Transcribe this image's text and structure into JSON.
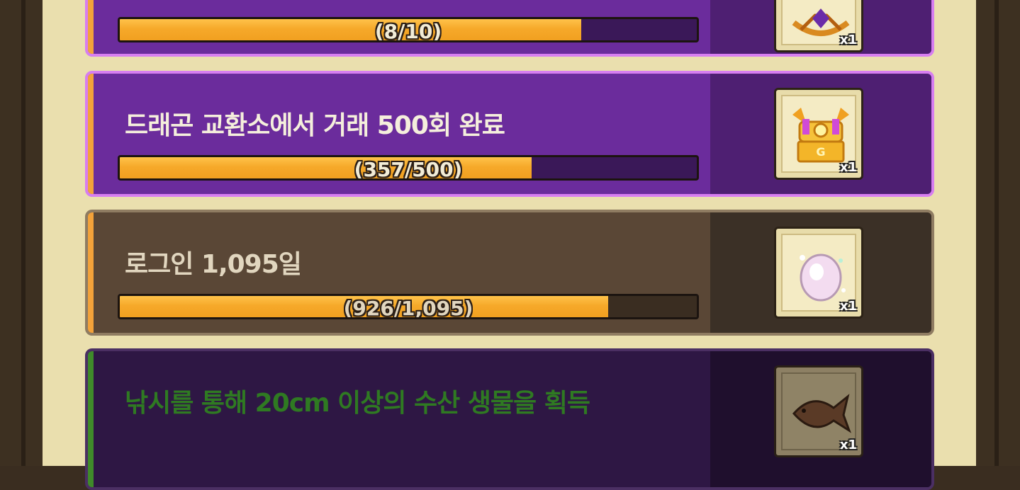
{
  "missions": [
    {
      "title": "",
      "progress_text": "(8/10)",
      "current": 8,
      "target": 10,
      "state": "active",
      "reward": {
        "icon": "gem-bow-icon",
        "qty": "x1"
      }
    },
    {
      "title": "드래곤 교환소에서 거래 500회 완료",
      "progress_text": "(357/500)",
      "current": 357,
      "target": 500,
      "state": "active",
      "reward": {
        "icon": "golden-treasure-chest-icon",
        "qty": "x1"
      }
    },
    {
      "title": "로그인 1,095일",
      "progress_text": "(926/1,095)",
      "current": 926,
      "target": 1095,
      "state": "inactive",
      "reward": {
        "icon": "pink-egg-icon",
        "qty": "x1"
      }
    },
    {
      "title": "낚시를 통해 20cm 이상의 수산 생물을 획득",
      "state": "locked",
      "reward": {
        "icon": "fish-icon",
        "qty": "x1"
      }
    }
  ],
  "colors": {
    "active_bg": "#6a2a9a",
    "inactive_bg": "#5a4736",
    "locked_bg": "#2e1744",
    "progress_fill": "#f6a92a",
    "locked_title": "#2f7a22"
  }
}
